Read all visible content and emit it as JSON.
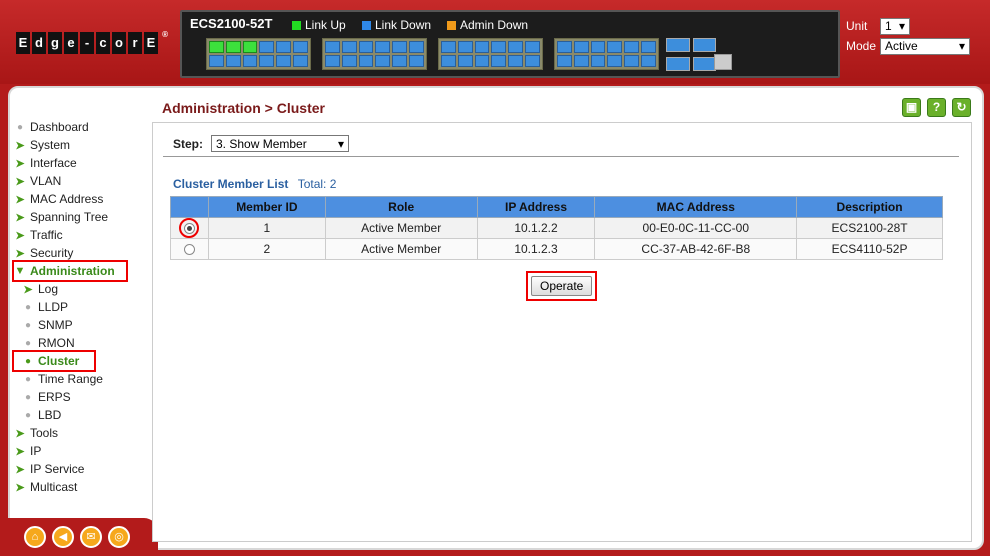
{
  "header": {
    "logo_letters": [
      "E",
      "d",
      "g",
      "e",
      "-",
      "c",
      "o",
      "r",
      "E"
    ],
    "logo_reg": "®",
    "model": "ECS2100-52T",
    "legend": [
      {
        "label": "Link Up",
        "color": "#22dd22"
      },
      {
        "label": "Link Down",
        "color": "#2f88e8"
      },
      {
        "label": "Admin Down",
        "color": "#f09a1a"
      }
    ],
    "unit_label": "Unit",
    "unit_value": "1",
    "mode_label": "Mode",
    "mode_value": "Active"
  },
  "sidebar": {
    "items": [
      {
        "label": "Dashboard"
      },
      {
        "label": "System"
      },
      {
        "label": "Interface"
      },
      {
        "label": "VLAN"
      },
      {
        "label": "MAC Address"
      },
      {
        "label": "Spanning Tree"
      },
      {
        "label": "Traffic"
      },
      {
        "label": "Security"
      },
      {
        "label": "Administration"
      },
      {
        "label": "Log"
      },
      {
        "label": "LLDP"
      },
      {
        "label": "SNMP"
      },
      {
        "label": "RMON"
      },
      {
        "label": "Cluster"
      },
      {
        "label": "Time Range"
      },
      {
        "label": "ERPS"
      },
      {
        "label": "LBD"
      },
      {
        "label": "Tools"
      },
      {
        "label": "IP"
      },
      {
        "label": "IP Service"
      },
      {
        "label": "Multicast"
      }
    ]
  },
  "page": {
    "title": "Administration > Cluster",
    "step_label": "Step:",
    "step_value": "3. Show Member",
    "list_title": "Cluster Member List",
    "list_total": "Total: 2",
    "operate_label": "Operate"
  },
  "table": {
    "headers": [
      "Member ID",
      "Role",
      "IP Address",
      "MAC Address",
      "Description"
    ],
    "rows": [
      {
        "id": "1",
        "role": "Active Member",
        "ip": "10.1.2.2",
        "mac": "00-E0-0C-11-CC-00",
        "desc": "ECS2100-28T",
        "selected": true
      },
      {
        "id": "2",
        "role": "Active Member",
        "ip": "10.1.2.3",
        "mac": "CC-37-AB-42-6F-B8",
        "desc": "ECS4110-52P",
        "selected": false
      }
    ]
  },
  "toolbar_icons": [
    "save-icon",
    "help-icon",
    "refresh-icon"
  ],
  "footer_icons": [
    "home-icon",
    "back-icon",
    "mail-icon",
    "web-icon"
  ]
}
